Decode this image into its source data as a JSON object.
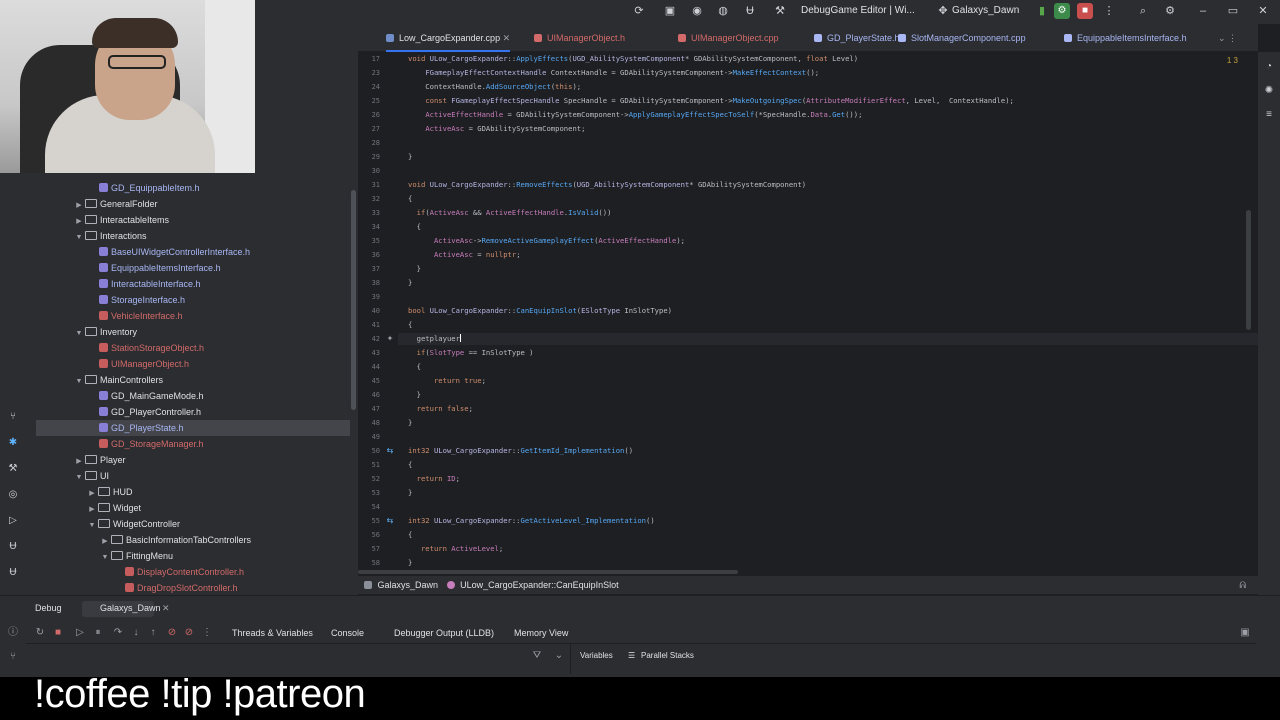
{
  "titlebar": {
    "run_config": "DebugGame Editor | Wi...",
    "project": "Galaxys_Dawn"
  },
  "project_tree": [
    {
      "label": "GD_EquippableItem.h",
      "kind": "file",
      "style": "h",
      "indent": 2
    },
    {
      "label": "GeneralFolder",
      "kind": "folder",
      "collapsed": true,
      "indent": 1
    },
    {
      "label": "InteractableItems",
      "kind": "folder",
      "collapsed": true,
      "indent": 1
    },
    {
      "label": "Interactions",
      "kind": "folder",
      "collapsed": false,
      "indent": 1
    },
    {
      "label": "BaseUIWidgetControllerInterface.h",
      "kind": "file",
      "style": "h",
      "indent": 2
    },
    {
      "label": "EquippableItemsInterface.h",
      "kind": "file",
      "style": "h",
      "indent": 2
    },
    {
      "label": "InteractableInterface.h",
      "kind": "file",
      "style": "h",
      "indent": 2
    },
    {
      "label": "StorageInterface.h",
      "kind": "file",
      "style": "h",
      "indent": 2
    },
    {
      "label": "VehicleInterface.h",
      "kind": "file",
      "style": "err",
      "indent": 2
    },
    {
      "label": "Inventory",
      "kind": "folder",
      "collapsed": false,
      "indent": 1
    },
    {
      "label": "StationStorageObject.h",
      "kind": "file",
      "style": "err",
      "indent": 2
    },
    {
      "label": "UIManagerObject.h",
      "kind": "file",
      "style": "err",
      "indent": 2
    },
    {
      "label": "MainControllers",
      "kind": "folder",
      "collapsed": false,
      "indent": 1
    },
    {
      "label": "GD_MainGameMode.h",
      "kind": "file",
      "style": "",
      "indent": 2
    },
    {
      "label": "GD_PlayerController.h",
      "kind": "file",
      "style": "",
      "indent": 2
    },
    {
      "label": "GD_PlayerState.h",
      "kind": "file",
      "style": "h",
      "indent": 2,
      "selected": true
    },
    {
      "label": "GD_StorageManager.h",
      "kind": "file",
      "style": "err",
      "indent": 2
    },
    {
      "label": "Player",
      "kind": "folder",
      "collapsed": true,
      "indent": 1
    },
    {
      "label": "UI",
      "kind": "folder",
      "collapsed": false,
      "indent": 1
    },
    {
      "label": "HUD",
      "kind": "folder",
      "collapsed": true,
      "indent": 2
    },
    {
      "label": "Widget",
      "kind": "folder",
      "collapsed": true,
      "indent": 2
    },
    {
      "label": "WidgetController",
      "kind": "folder",
      "collapsed": false,
      "indent": 2
    },
    {
      "label": "BasicInformationTabControllers",
      "kind": "folder",
      "collapsed": true,
      "indent": 3
    },
    {
      "label": "FittingMenu",
      "kind": "folder",
      "collapsed": false,
      "indent": 3
    },
    {
      "label": "DisplayContentController.h",
      "kind": "file",
      "style": "err",
      "indent": 4
    },
    {
      "label": "DragDropSlotController.h",
      "kind": "file",
      "style": "err",
      "indent": 4
    }
  ],
  "tabs": [
    {
      "label": "Low_CargoExpander.cpp",
      "active": true,
      "color": "#6f8ec9"
    },
    {
      "label": "UIManagerObject.h",
      "active": false,
      "color": "#d36a6a"
    },
    {
      "label": "UIManagerObject.cpp",
      "active": false,
      "color": "#d36a6a"
    },
    {
      "label": "GD_PlayerState.h",
      "active": false,
      "color": "#a9b7f5"
    },
    {
      "label": "SlotManagerComponent.cpp",
      "active": false,
      "color": "#a9b7f5"
    },
    {
      "label": "EquippableItemsInterface.h",
      "active": false,
      "color": "#a9b7f5"
    }
  ],
  "inspection_summary": "1  3",
  "code_lines": [
    {
      "n": "17",
      "html": "<span class='kw'>void</span> <span class='cl'>ULow_CargoExpander</span>::<span class='fn'>ApplyEffects</span>(<span class='cl'>UGD_AbilitySystemComponent</span>* GDAbilitySystemComponent, <span class='kw'>float</span> Level)"
    },
    {
      "n": "23",
      "html": "    <span class='cl'>FGameplayEffectContextHandle</span> ContextHandle = GDAbilitySystemComponent-><span class='fn'>MakeEffectContext</span>();"
    },
    {
      "n": "24",
      "html": "    ContextHandle.<span class='fn'>AddSourceObject</span>(<span class='kw'>this</span>);"
    },
    {
      "n": "25",
      "html": "    <span class='kw'>const</span> <span class='cl'>FGameplayEffectSpecHandle</span> SpecHandle = GDAbilitySystemComponent-><span class='fn'>MakeOutgoingSpec</span>(<span class='mb'>AttributeModifierEffect</span>, Level,  ContextHandle);"
    },
    {
      "n": "26",
      "html": "    <span class='mb'>ActiveEffectHandle</span> = GDAbilitySystemComponent-><span class='fn'>ApplyGameplayEffectSpecToSelf</span>(*SpecHandle.<span class='mb'>Data</span>.<span class='fn'>Get</span>());"
    },
    {
      "n": "27",
      "html": "    <span class='mb'>ActiveAsc</span> = GDAbilitySystemComponent;"
    },
    {
      "n": "28",
      "html": ""
    },
    {
      "n": "29",
      "html": "}"
    },
    {
      "n": "30",
      "html": ""
    },
    {
      "n": "31",
      "html": "<span class='kw'>void</span> <span class='cl'>ULow_CargoExpander</span>::<span class='fn'>RemoveEffects</span>(<span class='cl'>UGD_AbilitySystemComponent</span>* GDAbilitySystemComponent)"
    },
    {
      "n": "32",
      "html": "{"
    },
    {
      "n": "33",
      "html": "  <span class='kw'>if</span>(<span class='mb'>ActiveAsc</span> && <span class='mb'>ActiveEffectHandle</span>.<span class='fn'>IsValid</span>())"
    },
    {
      "n": "34",
      "html": "  {"
    },
    {
      "n": "35",
      "html": "      <span class='mb'>ActiveAsc</span>-><span class='fn'>RemoveActiveGameplayEffect</span>(<span class='mb'>ActiveEffectHandle</span>);"
    },
    {
      "n": "36",
      "html": "      <span class='mb'>ActiveAsc</span> = <span class='kw'>nullptr</span>;"
    },
    {
      "n": "37",
      "html": "  }"
    },
    {
      "n": "38",
      "html": "}"
    },
    {
      "n": "39",
      "html": ""
    },
    {
      "n": "40",
      "html": "<span class='kw'>bool</span> <span class='cl'>ULow_CargoExpander</span>::<span class='fn'>CanEquipInSlot</span>(<span class='cl'>ESlotType</span> InSlotType)"
    },
    {
      "n": "41",
      "html": "{"
    },
    {
      "n": "42",
      "html": "  getplayuer<span class='cursor'></span>",
      "current": true
    },
    {
      "n": "43",
      "html": "  <span class='kw'>if</span>(<span class='mb'>SlotType</span> == InSlotType )"
    },
    {
      "n": "44",
      "html": "  {"
    },
    {
      "n": "45",
      "html": "      <span class='kw'>return</span> <span class='kw'>true</span>;"
    },
    {
      "n": "46",
      "html": "  }"
    },
    {
      "n": "47",
      "html": "  <span class='kw'>return</span> <span class='kw'>false</span>;"
    },
    {
      "n": "48",
      "html": "}"
    },
    {
      "n": "49",
      "html": ""
    },
    {
      "n": "50",
      "html": "<span class='kw'>int32</span> <span class='cl'>ULow_CargoExpander</span>::<span class='fn'>GetItemId_Implementation</span>()",
      "marker": true
    },
    {
      "n": "51",
      "html": "{"
    },
    {
      "n": "52",
      "html": "  <span class='kw'>return</span> <span class='mb'>ID</span>;"
    },
    {
      "n": "53",
      "html": "}"
    },
    {
      "n": "54",
      "html": ""
    },
    {
      "n": "55",
      "html": "<span class='kw'>int32</span> <span class='cl'>ULow_CargoExpander</span>::<span class='fn'>GetActiveLevel_Implementation</span>()",
      "marker": true
    },
    {
      "n": "56",
      "html": "{"
    },
    {
      "n": "57",
      "html": "   <span class='kw'>return</span> <span class='mb'>ActiveLevel</span>;"
    },
    {
      "n": "58",
      "html": "}"
    }
  ],
  "breadcrumbs": {
    "project": "Galaxys_Dawn",
    "symbol": "ULow_CargoExpander::CanEquipInSlot"
  },
  "debug": {
    "title": "Debug",
    "session": "Galaxys_Dawn",
    "tabs": [
      "Threads & Variables",
      "Console",
      "Debugger Output (LLDB)",
      "Memory View"
    ],
    "subtabs": [
      "Variables",
      "Parallel Stacks"
    ]
  },
  "overlay": {
    "text": "!coffee !tip !patreon"
  }
}
